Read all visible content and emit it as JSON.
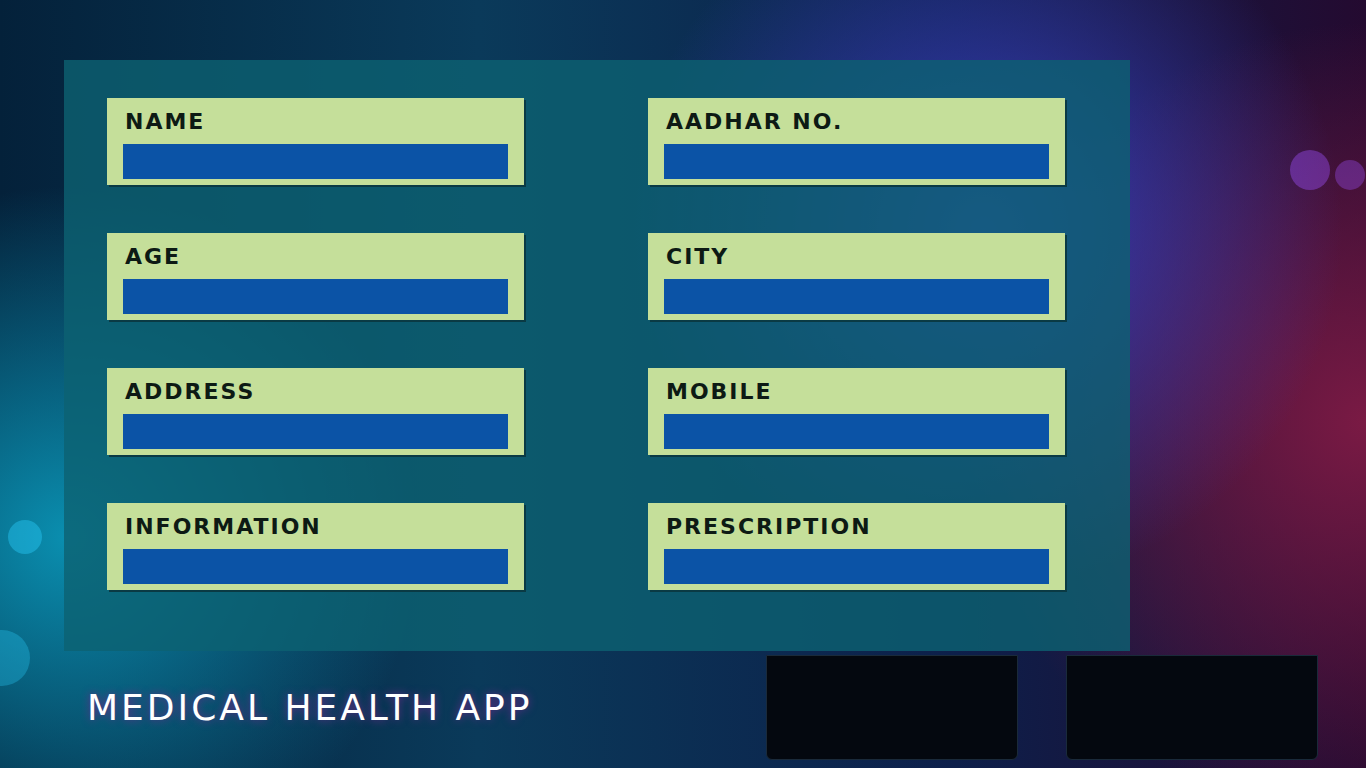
{
  "app": {
    "title": "MEDICAL HEALTH APP"
  },
  "form": {
    "fields": [
      {
        "label": "NAME"
      },
      {
        "label": "AADHAR NO."
      },
      {
        "label": "AGE"
      },
      {
        "label": "CITY"
      },
      {
        "label": "ADDRESS"
      },
      {
        "label": "MOBILE"
      },
      {
        "label": "INFORMATION"
      },
      {
        "label": "PRESCRIPTION"
      }
    ]
  }
}
